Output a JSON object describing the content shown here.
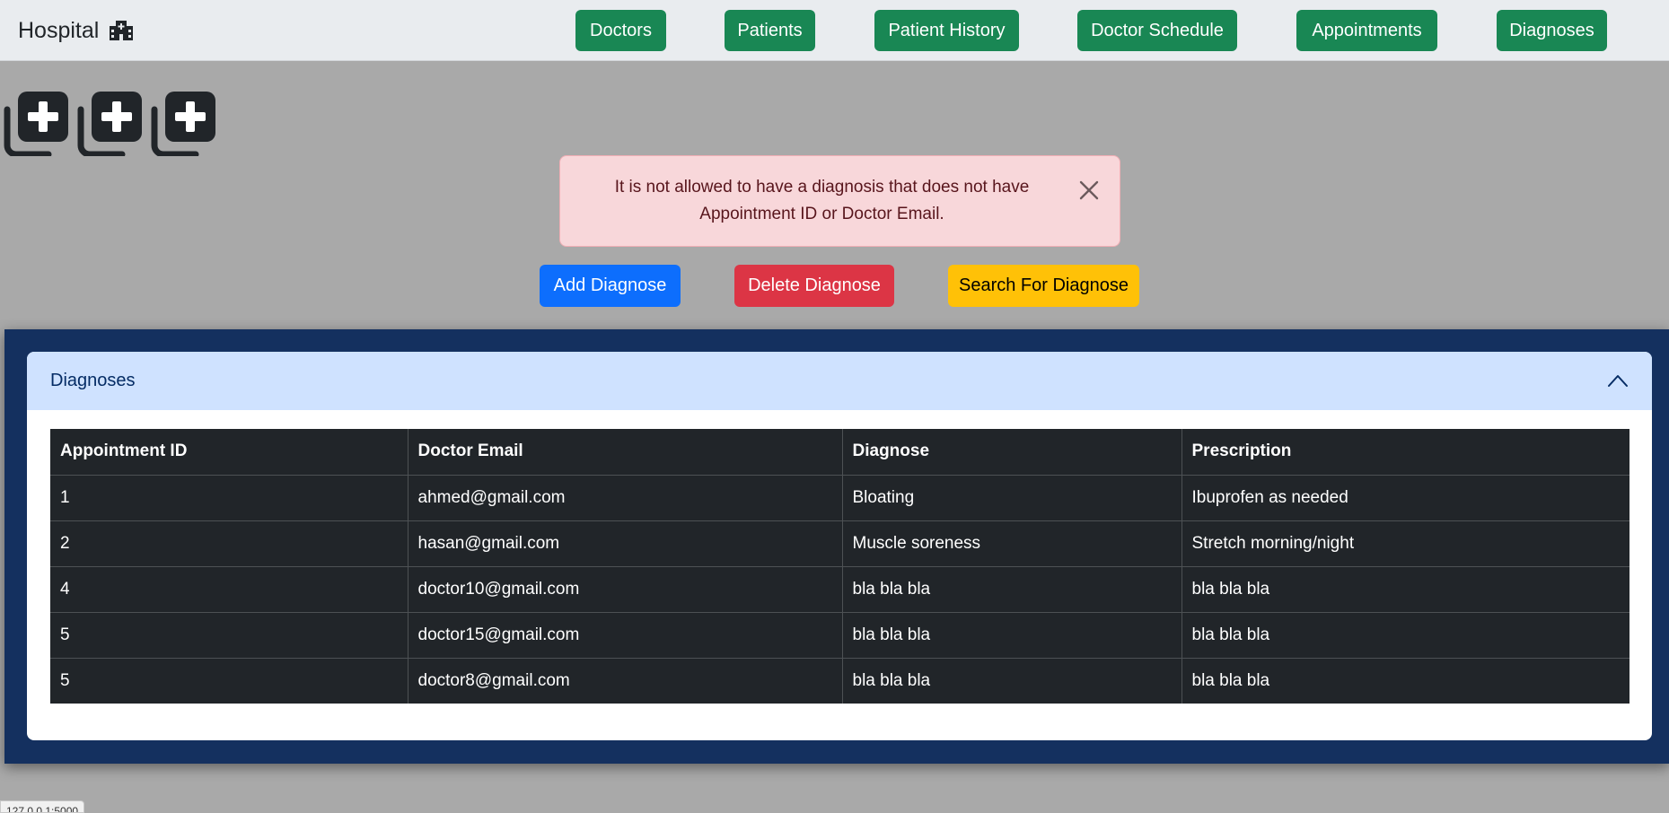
{
  "brand": {
    "title": "Hospital",
    "icon": "hospital-icon"
  },
  "nav": {
    "items": [
      {
        "label": "Doctors"
      },
      {
        "label": "Patients"
      },
      {
        "label": "Patient History"
      },
      {
        "label": "Doctor Schedule"
      },
      {
        "label": "Appointments"
      },
      {
        "label": "Diagnoses"
      }
    ],
    "color": "#198754"
  },
  "icons": [
    "copy-plus-icon",
    "copy-plus-icon",
    "copy-plus-icon"
  ],
  "alert": {
    "message": "It is not allowed to have a diagnosis that does not have Appointment ID or Doctor Email.",
    "close_icon": "close-icon"
  },
  "actions": {
    "add_label": "Add Diagnose",
    "delete_label": "Delete Diagnose",
    "search_label": "Search For Diagnose"
  },
  "panel": {
    "header": "Diagnoses",
    "toggle_icon": "chevron-up-icon"
  },
  "table": {
    "columns": [
      "Appointment ID",
      "Doctor Email",
      "Diagnose",
      "Prescription"
    ],
    "rows": [
      [
        "1",
        "ahmed@gmail.com",
        "Bloating",
        "Ibuprofen as needed"
      ],
      [
        "2",
        "hasan@gmail.com",
        "Muscle soreness",
        "Stretch morning/night"
      ],
      [
        "4",
        "doctor10@gmail.com",
        "bla bla bla",
        "bla bla bla"
      ],
      [
        "5",
        "doctor15@gmail.com",
        "bla bla bla",
        "bla bla bla"
      ],
      [
        "5",
        "doctor8@gmail.com",
        "bla bla bla",
        "bla bla bla"
      ]
    ]
  },
  "status_bar": {
    "text": "127.0.0.1:5000"
  },
  "colors": {
    "page_bg": "#a9a9a9",
    "panel_bg": "#14305f",
    "alert_bg": "#f8d7da",
    "table_bg": "#212529"
  }
}
